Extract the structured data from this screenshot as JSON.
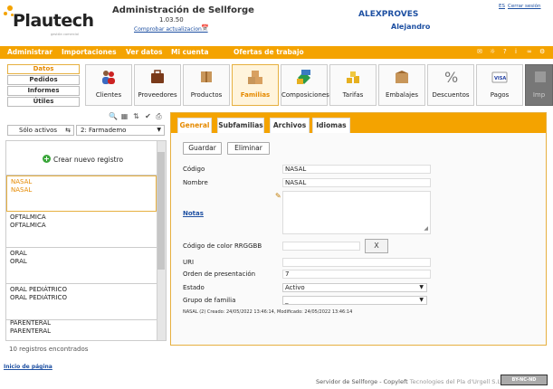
{
  "header": {
    "brand": "Plautech",
    "tagline": "gestión comercial",
    "app_title": "Administración de Sellforge",
    "version": "1.03.50",
    "update_link": "Comprobar actualizaciones",
    "company": "ALEXPROVES",
    "user": "Alejandro",
    "lang": "ES",
    "logout": "Cerrar sesión"
  },
  "menubar": {
    "items": [
      "Administrar",
      "Importaciones",
      "Ver datos",
      "Mi cuenta",
      "Ofertas de trabajo"
    ]
  },
  "modules": [
    "Datos",
    "Pedidos",
    "Informes",
    "Útiles"
  ],
  "tiles": [
    "Clientes",
    "Proveedores",
    "Productos",
    "Familias",
    "Composiciones",
    "Tarifas",
    "Embalajes",
    "Descuentos",
    "Pagos",
    "Imp"
  ],
  "filters": {
    "active": "Sólo activos",
    "category": "2: Farmademo"
  },
  "list": {
    "new_record": "Crear nuevo registro",
    "items": [
      {
        "a": "NASAL",
        "b": "NASAL"
      },
      {
        "a": "OFTALMICA",
        "b": "OFTALMICA"
      },
      {
        "a": "ORAL",
        "b": "ORAL"
      },
      {
        "a": "ORAL PEDIÁTRICO",
        "b": "ORAL PEDIÁTRICO"
      },
      {
        "a": "PARENTERAL",
        "b": "PARENTERAL"
      }
    ],
    "count": "10 registros encontrados"
  },
  "top_link": "Inicio de página",
  "tabs": [
    "General",
    "Subfamilias",
    "Archivos",
    "Idiomas"
  ],
  "buttons": {
    "save": "Guardar",
    "delete": "Eliminar"
  },
  "form": {
    "codigo_label": "Código",
    "codigo_value": "NASAL",
    "nombre_label": "Nombre",
    "nombre_value": "NASAL",
    "notas_label": "Notas",
    "color_label": "Código de color RRGGBB",
    "color_clear": "X",
    "uri_label": "URI",
    "orden_label": "Orden de presentación",
    "orden_value": "7",
    "estado_label": "Estado",
    "estado_value": "Activo",
    "grupo_label": "Grupo de familia",
    "grupo_value": "_",
    "meta": "NASAL (2) Creado: 24/05/2022 13:46:14, Modificado: 24/05/2022 13:46:14"
  },
  "footer": {
    "server": "Servidor de Sellforge - Copyleft",
    "credit": "Tecnologies del Pla d'Urgell S.L.",
    "license": "BY-NC-ND"
  }
}
